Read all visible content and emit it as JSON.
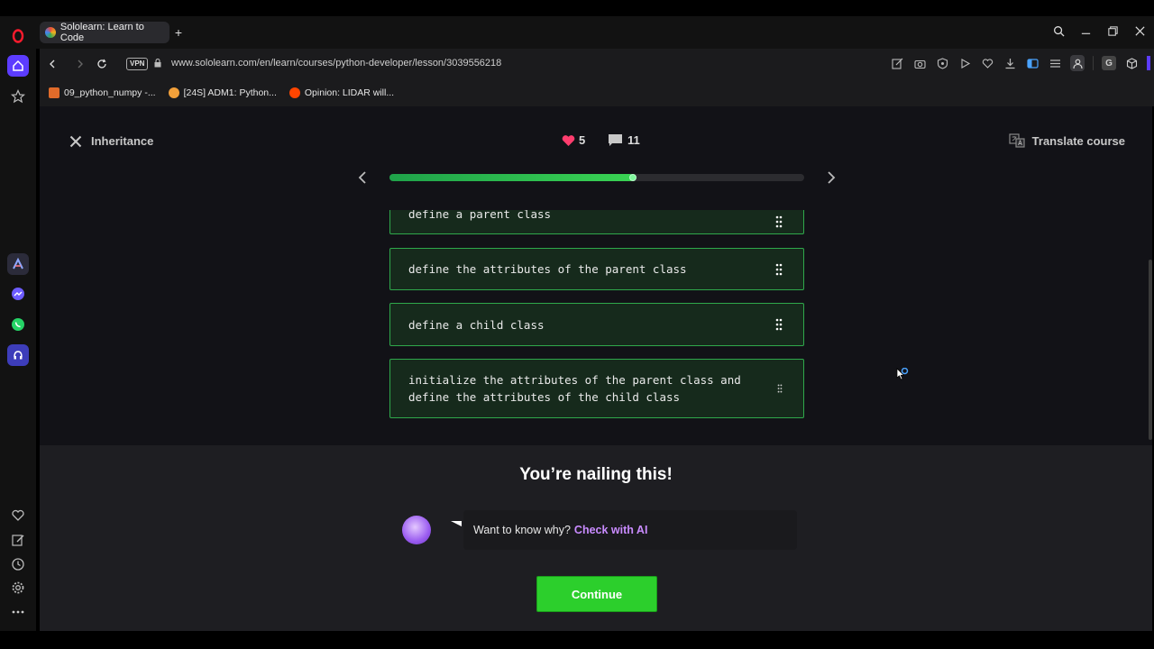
{
  "browser": {
    "tab_title": "Sololearn: Learn to Code",
    "newtab_label": "+",
    "vpn_label": "VPN",
    "url": "www.sololearn.com/en/learn/courses/python-developer/lesson/3039556218",
    "extension_g": "G",
    "bookmarks": [
      {
        "label": "09_python_numpy -...",
        "color": "#e06b2a"
      },
      {
        "label": "[24S] ADM1: Python...",
        "color": "#f2a03a"
      },
      {
        "label": "Opinion: LIDAR will...",
        "color": "#ff4500"
      }
    ],
    "accent": "#5c3cff"
  },
  "lesson": {
    "title": "Inheritance",
    "hearts": "5",
    "comments": "11",
    "translate_label": "Translate course",
    "progress": 0.59
  },
  "cards": [
    {
      "text": "define a parent class"
    },
    {
      "text": "define the attributes of the parent class"
    },
    {
      "text": "define a child class"
    },
    {
      "text": "initialize the attributes of the parent class and define the attributes of the child class"
    }
  ],
  "feedback": {
    "heading": "You’re nailing this!",
    "ai_prompt": "Want to know why?",
    "ai_link": "Check with AI",
    "continue_label": "Continue"
  },
  "colors": {
    "success_green": "#2ccf2c",
    "card_border": "#2fa84b",
    "heart": "#ff3d6e",
    "ai_link": "#c98bff"
  }
}
